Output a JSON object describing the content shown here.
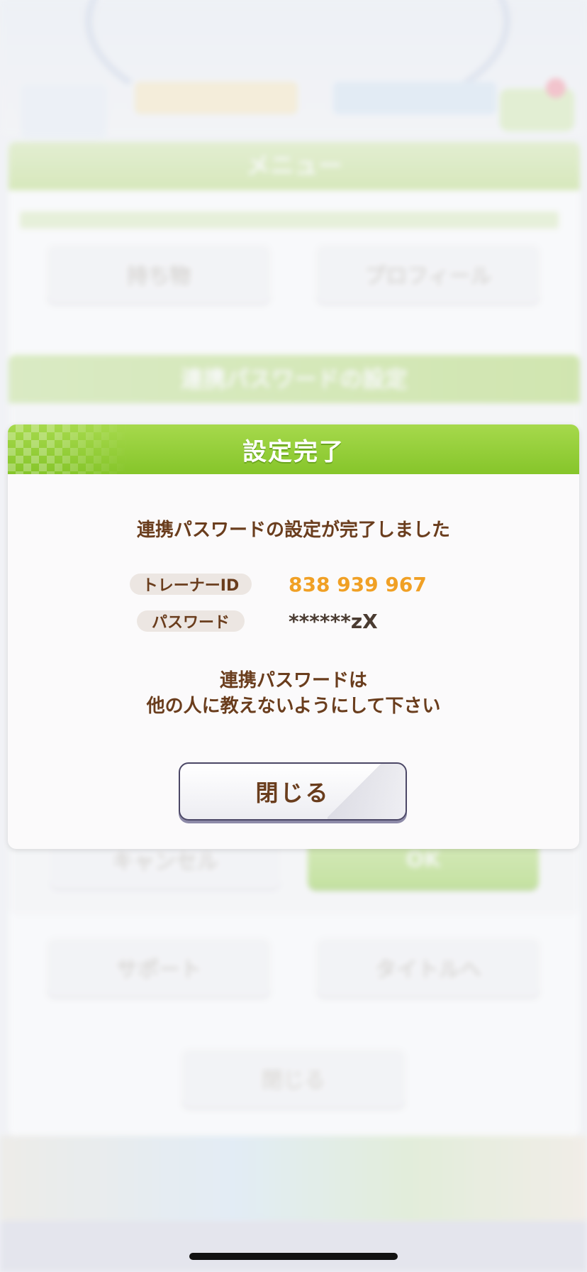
{
  "background": {
    "menu_title": "メニュー",
    "menu_items": [
      "持ち物",
      "プロフィール",
      "サポート",
      "タイトルへ"
    ],
    "sub_dialog_title": "連携パスワードの設定",
    "sub_cancel_label": "キャンセル",
    "sub_ok_label": "OK",
    "close_label": "閉じる"
  },
  "dialog": {
    "title": "設定完了",
    "message": "連携パスワードの設定が完了しました",
    "trainer_id_label": "トレーナーID",
    "trainer_id_value": "838 939 967",
    "password_label": "パスワード",
    "password_value": "******zX",
    "note_line1": "連携パスワードは",
    "note_line2": "他の人に教えないようにして下さい",
    "close_label": "閉じる"
  },
  "colors": {
    "header_green": "#86c52a",
    "text_brown": "#6a3d1d",
    "id_orange": "#f0a025"
  }
}
